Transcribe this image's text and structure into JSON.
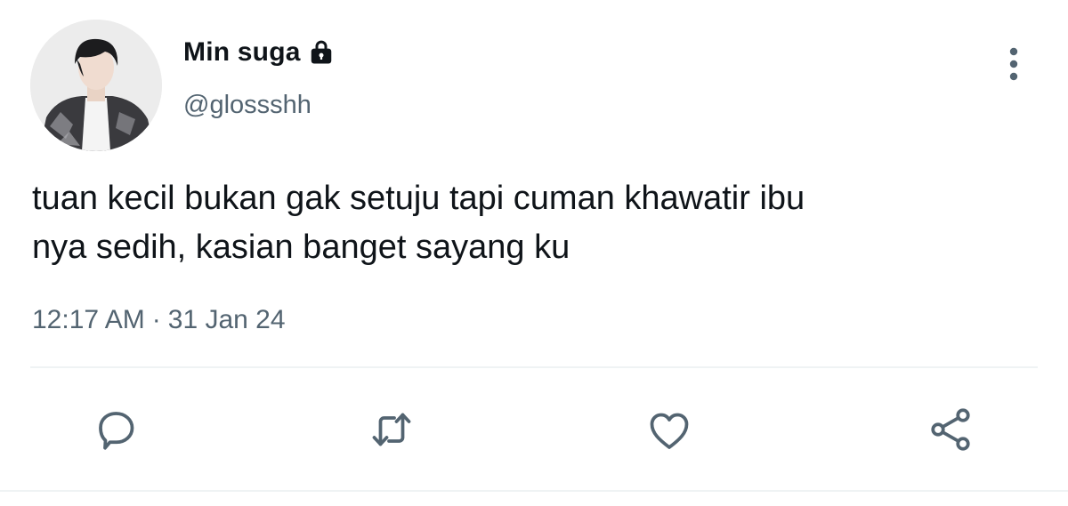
{
  "user": {
    "display_name": "Min suga",
    "handle": "@glossshh",
    "protected_icon": "lock-icon",
    "avatar": "avatar"
  },
  "tweet": {
    "text_line1": "tuan kecil bukan gak setuju tapi cuman khawatir ibu",
    "text_line2": "nya sedih, kasian banget sayang ku",
    "time": "12:17 AM",
    "separator": "·",
    "date": "31 Jan 24"
  },
  "actions": {
    "reply": "reply-icon",
    "retweet": "retweet-icon",
    "like": "heart-icon",
    "share": "share-icon"
  },
  "menu": {
    "more": "more-vertical-icon"
  },
  "colors": {
    "text": "#0f1419",
    "secondary": "#536471",
    "divider": "#eff3f4"
  }
}
